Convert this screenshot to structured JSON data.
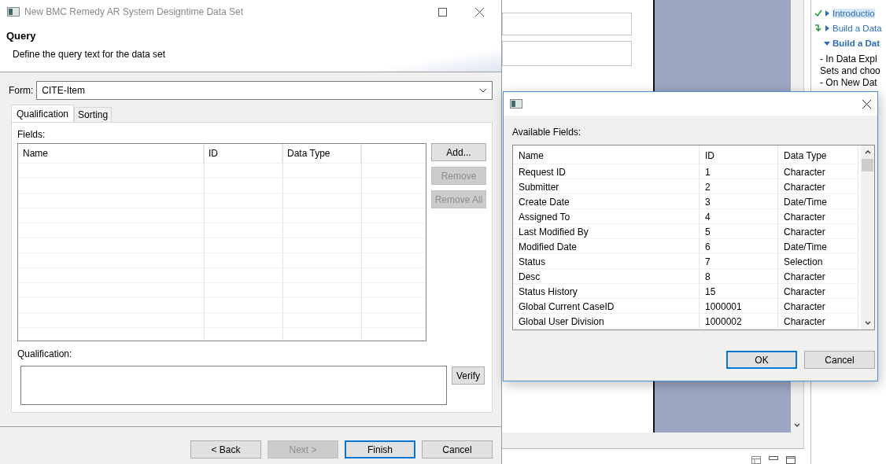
{
  "main_dialog": {
    "title": "New BMC Remedy AR System Designtime Data Set",
    "header_title": "Query",
    "header_description": "Define the query text for the data set",
    "form_label": "Form:",
    "form_value": "CITE-Item",
    "tabs": [
      {
        "label": "Qualification",
        "selected": true
      },
      {
        "label": "Sorting",
        "selected": false
      }
    ],
    "fields_label": "Fields:",
    "columns": [
      "Name",
      "ID",
      "Data Type"
    ],
    "side_buttons": [
      {
        "label": "Add...",
        "disabled": false
      },
      {
        "label": "Remove",
        "disabled": true
      },
      {
        "label": "Remove All",
        "disabled": true
      }
    ],
    "qualification_label": "Qualification:",
    "verify_button": "Verify",
    "footer_buttons": [
      {
        "label": "< Back",
        "disabled": false,
        "default": false
      },
      {
        "label": "Next >",
        "disabled": true,
        "default": false
      },
      {
        "label": "Finish",
        "disabled": false,
        "default": true
      },
      {
        "label": "Cancel",
        "disabled": false,
        "default": false
      }
    ]
  },
  "fields_dialog": {
    "label": "Available Fields:",
    "columns": [
      "Name",
      "ID",
      "Data Type"
    ],
    "rows": [
      {
        "name": "Request ID",
        "id": "1",
        "type": "Character"
      },
      {
        "name": "Submitter",
        "id": "2",
        "type": "Character"
      },
      {
        "name": "Create Date",
        "id": "3",
        "type": "Date/Time"
      },
      {
        "name": "Assigned To",
        "id": "4",
        "type": "Character"
      },
      {
        "name": "Last Modified By",
        "id": "5",
        "type": "Character"
      },
      {
        "name": "Modified Date",
        "id": "6",
        "type": "Date/Time"
      },
      {
        "name": "Status",
        "id": "7",
        "type": "Selection"
      },
      {
        "name": "Desc",
        "id": "8",
        "type": "Character"
      },
      {
        "name": "Status History",
        "id": "15",
        "type": "Character"
      },
      {
        "name": "Global Current CaseID",
        "id": "1000001",
        "type": "Character"
      },
      {
        "name": "Global User Division",
        "id": "1000002",
        "type": "Character"
      }
    ],
    "buttons": [
      {
        "label": "OK",
        "default": true
      },
      {
        "label": "Cancel",
        "default": false
      }
    ]
  },
  "cheat_sheet": {
    "items": [
      {
        "kind": "done",
        "label": "Introductio",
        "selected": true
      },
      {
        "kind": "next",
        "label": "Build a Data",
        "selected": false
      },
      {
        "kind": "expanded",
        "label": "Build a Dat",
        "selected": false
      }
    ],
    "lines": [
      "- In Data Expl",
      "Sets and choo",
      "- On New Dat"
    ]
  }
}
